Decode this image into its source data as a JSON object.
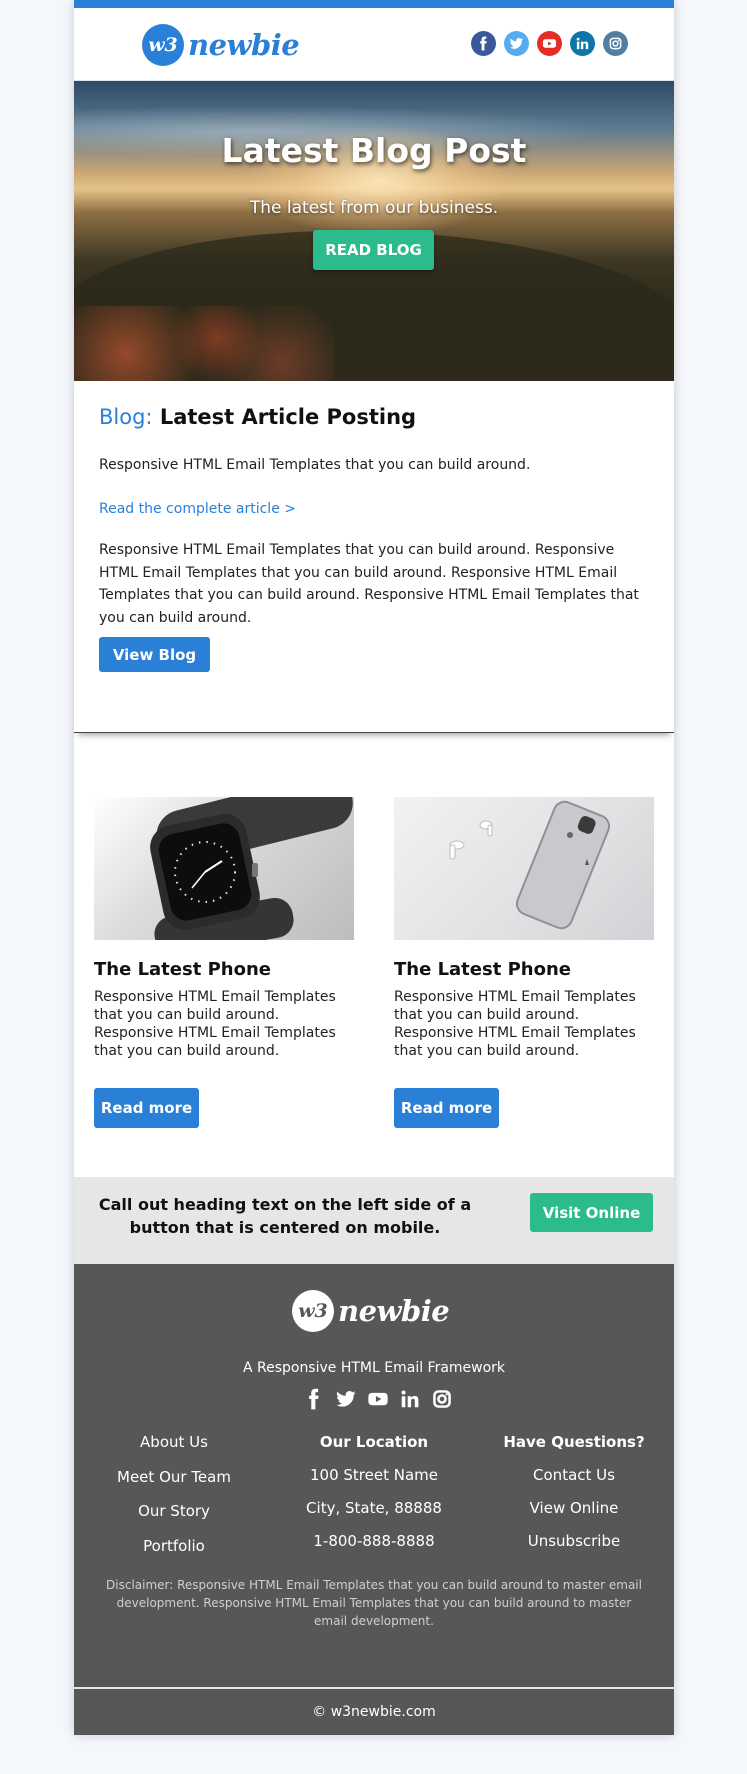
{
  "brand": {
    "logo_mark": "w3",
    "logo_word": "newbie"
  },
  "header": {
    "social": [
      {
        "name": "facebook",
        "glyph": "f",
        "color": "#3b5998"
      },
      {
        "name": "twitter",
        "glyph": "t",
        "color": "#55acee"
      },
      {
        "name": "youtube",
        "glyph": "yt",
        "color": "#e52d27"
      },
      {
        "name": "linkedin",
        "glyph": "in",
        "color": "#0e76a8"
      },
      {
        "name": "instagram",
        "glyph": "ig",
        "color": "#517fa4"
      }
    ]
  },
  "hero": {
    "title": "Latest Blog Post",
    "subtitle": "The latest from our business.",
    "button": "READ BLOG"
  },
  "article": {
    "label": "Blog:",
    "title": "Latest Article Posting",
    "intro": "Responsive HTML Email Templates that you can build around.",
    "link": "Read the complete article >",
    "body": "Responsive HTML Email Templates that you can build around. Responsive HTML Email Templates that you can build around. Responsive HTML Email Templates that you can build around. Responsive HTML Email Templates that you can build around.",
    "button": "View Blog"
  },
  "products": [
    {
      "title": "The Latest Phone",
      "text": "Responsive HTML Email Templates that you can build around. Responsive HTML Email Templates that you can build around.",
      "button": "Read more"
    },
    {
      "title": "The Latest Phone",
      "text": "Responsive HTML Email Templates that you can build around. Responsive HTML Email Templates that you can build around.",
      "button": "Read more"
    }
  ],
  "callout": {
    "text": "Call out heading text on the left side of a button that is centered on mobile.",
    "button": "Visit Online"
  },
  "footer": {
    "tagline": "A Responsive HTML Email Framework",
    "col1": [
      "About Us",
      "Meet Our Team",
      "Our Story",
      "Portfolio"
    ],
    "col2": {
      "heading": "Our Location",
      "items": [
        "100 Street Name",
        "City, State, 88888",
        "1-800-888-8888"
      ]
    },
    "col3": {
      "heading": "Have Questions?",
      "items": [
        "Contact Us",
        "View Online",
        "Unsubscribe"
      ]
    },
    "disclaimer": "Disclaimer: Responsive HTML Email Templates that you can build around to master email development. Responsive HTML Email Templates that you can build around to master email development.",
    "copyright": "© w3newbie.com"
  },
  "colors": {
    "accent": "#2a7fd6",
    "green": "#2bbb8c",
    "footer_bg": "#575757",
    "callout_bg": "#e6e6e6"
  }
}
